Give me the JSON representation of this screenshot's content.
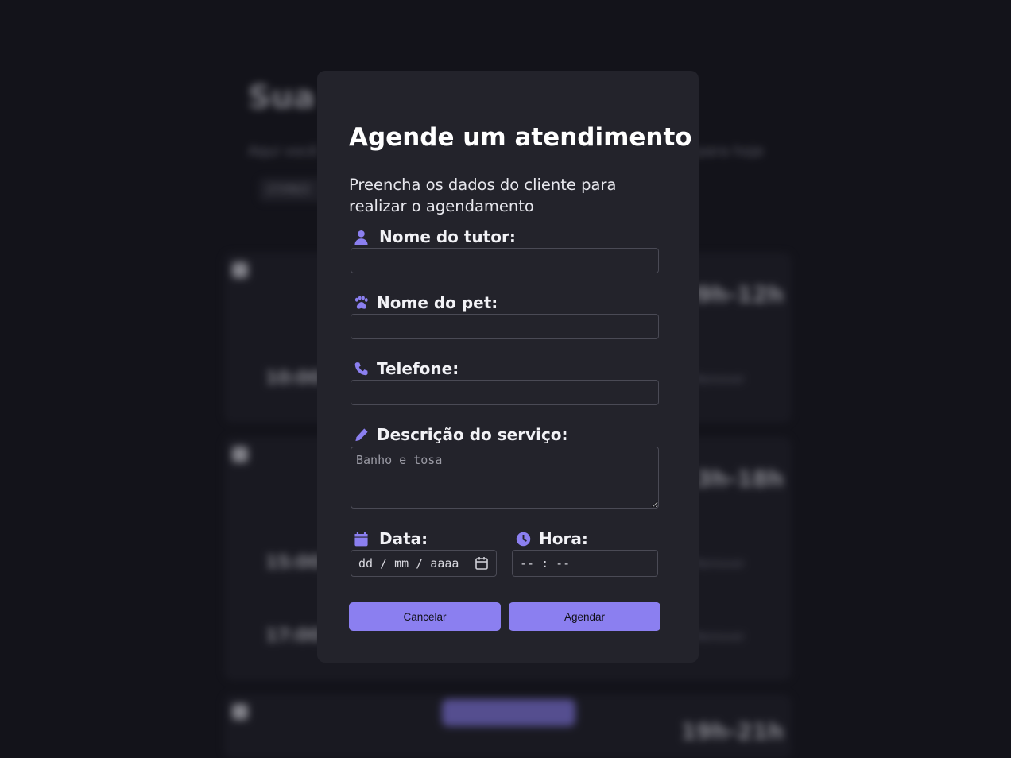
{
  "background": {
    "page_title": "Sua agenda",
    "page_subtitle_left": "Aqui você",
    "page_subtitle_right": "para hoje",
    "date_filter": "27/06/2",
    "sections": [
      {
        "icon": "sun-icon",
        "time_range": "09h-12h",
        "appointments": [
          {
            "time": "10:00",
            "action": "Remover"
          }
        ]
      },
      {
        "icon": "cloud-sun-icon",
        "time_range": "13h-18h",
        "appointments": [
          {
            "time": "15:00",
            "action": "Remover"
          },
          {
            "time": "17:00",
            "action": "Remover"
          }
        ]
      },
      {
        "icon": "moon-icon",
        "time_range": "19h-21h",
        "appointments": []
      }
    ],
    "new_appointment_button": "Novo agendamento"
  },
  "modal": {
    "title": "Agende um atendimento",
    "description": "Preencha os dados do cliente para realizar o agendamento",
    "fields": {
      "tutor": {
        "label": "Nome do tutor:",
        "icon": "user-icon",
        "value": ""
      },
      "pet": {
        "label": "Nome do pet:",
        "icon": "paw-icon",
        "value": ""
      },
      "phone": {
        "label": "Telefone:",
        "icon": "phone-icon",
        "value": ""
      },
      "service": {
        "label": "Descrição do serviço:",
        "icon": "pencil-icon",
        "value": "",
        "placeholder": "Banho e tosa"
      },
      "date": {
        "label": "Data:",
        "icon": "calendar-icon",
        "value": "dd / mm / aaaa"
      },
      "time": {
        "label": "Hora:",
        "icon": "clock-icon",
        "value": "-- : --"
      }
    },
    "buttons": {
      "cancel": "Cancelar",
      "submit": "Agendar"
    }
  },
  "colors": {
    "accent": "#8b7ff0",
    "modal_bg": "#23232b",
    "page_bg": "#13131a"
  }
}
